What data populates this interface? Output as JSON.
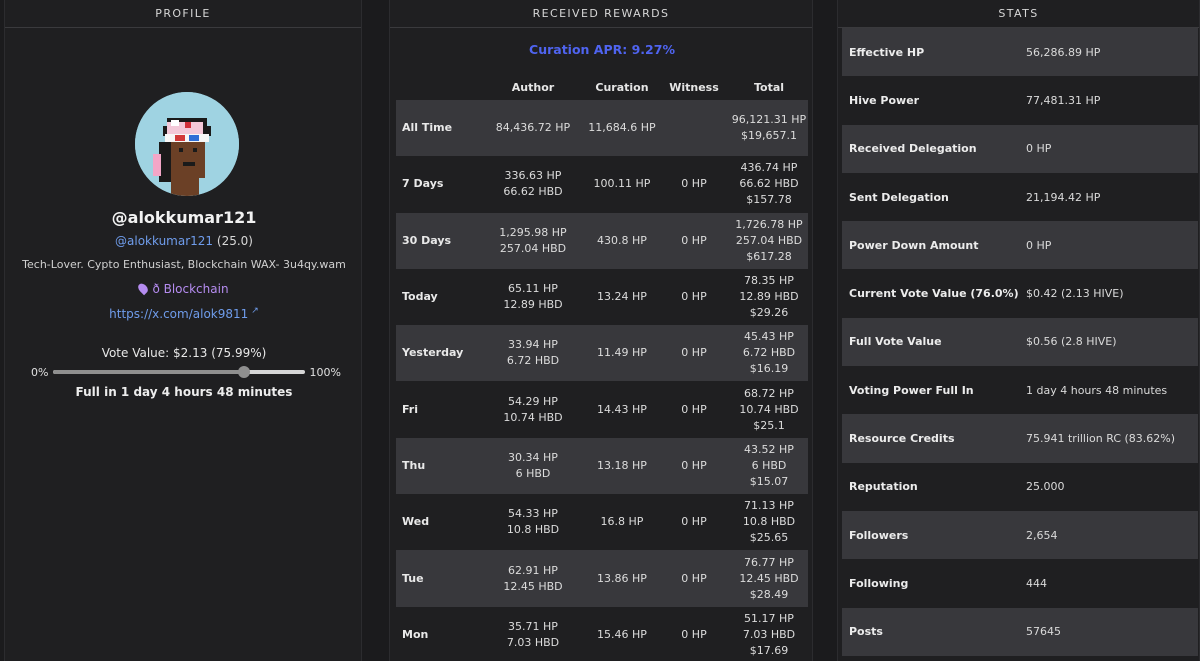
{
  "profile": {
    "header": "PROFILE",
    "username": "@alokkumar121",
    "handle": "@alokkumar121",
    "reputation": "(25.0)",
    "bio": "Tech-Lover. Cypto Enthusiast, Blockchain WAX- 3u4qy.wam",
    "location": "ð Blockchain",
    "website": "https://x.com/alok9811",
    "vote_value": "Vote Value: $2.13 (75.99%)",
    "slider_min": "0%",
    "slider_max": "100%",
    "vote_power_fraction": 0.7599,
    "full_in": "Full in 1 day 4 hours 48 minutes"
  },
  "rewards": {
    "header": "RECEIVED REWARDS",
    "apr": "Curation APR: 9.27%",
    "columns": [
      "",
      "Author",
      "Curation",
      "Witness",
      "Total"
    ],
    "rows": [
      {
        "label": "All Time",
        "author": [
          "84,436.72 HP"
        ],
        "curation": "11,684.6 HP",
        "witness": "",
        "total": [
          "96,121.31 HP",
          "$19,657.1"
        ]
      },
      {
        "label": "7 Days",
        "author": [
          "336.63 HP",
          "66.62 HBD"
        ],
        "curation": "100.11 HP",
        "witness": "0 HP",
        "total": [
          "436.74 HP",
          "66.62 HBD",
          "$157.78"
        ]
      },
      {
        "label": "30 Days",
        "author": [
          "1,295.98 HP",
          "257.04 HBD"
        ],
        "curation": "430.8 HP",
        "witness": "0 HP",
        "total": [
          "1,726.78 HP",
          "257.04 HBD",
          "$617.28"
        ]
      },
      {
        "label": "Today",
        "author": [
          "65.11 HP",
          "12.89 HBD"
        ],
        "curation": "13.24 HP",
        "witness": "0 HP",
        "total": [
          "78.35 HP",
          "12.89 HBD",
          "$29.26"
        ]
      },
      {
        "label": "Yesterday",
        "author": [
          "33.94 HP",
          "6.72 HBD"
        ],
        "curation": "11.49 HP",
        "witness": "0 HP",
        "total": [
          "45.43 HP",
          "6.72 HBD",
          "$16.19"
        ]
      },
      {
        "label": "Fri",
        "author": [
          "54.29 HP",
          "10.74 HBD"
        ],
        "curation": "14.43 HP",
        "witness": "0 HP",
        "total": [
          "68.72 HP",
          "10.74 HBD",
          "$25.1"
        ]
      },
      {
        "label": "Thu",
        "author": [
          "30.34 HP",
          "6 HBD"
        ],
        "curation": "13.18 HP",
        "witness": "0 HP",
        "total": [
          "43.52 HP",
          "6 HBD",
          "$15.07"
        ]
      },
      {
        "label": "Wed",
        "author": [
          "54.33 HP",
          "10.8 HBD"
        ],
        "curation": "16.8 HP",
        "witness": "0 HP",
        "total": [
          "71.13 HP",
          "10.8 HBD",
          "$25.65"
        ]
      },
      {
        "label": "Tue",
        "author": [
          "62.91 HP",
          "12.45 HBD"
        ],
        "curation": "13.86 HP",
        "witness": "0 HP",
        "total": [
          "76.77 HP",
          "12.45 HBD",
          "$28.49"
        ]
      },
      {
        "label": "Mon",
        "author": [
          "35.71 HP",
          "7.03 HBD"
        ],
        "curation": "15.46 HP",
        "witness": "0 HP",
        "total": [
          "51.17 HP",
          "7.03 HBD",
          "$17.69"
        ]
      }
    ]
  },
  "stats": {
    "header": "STATS",
    "rows": [
      {
        "label": "Effective HP",
        "value": "56,286.89 HP"
      },
      {
        "label": "Hive Power",
        "value": "77,481.31 HP"
      },
      {
        "label": "Received Delegation",
        "value": "0 HP"
      },
      {
        "label": "Sent Delegation",
        "value": "21,194.42 HP"
      },
      {
        "label": "Power Down Amount",
        "value": "0 HP"
      },
      {
        "label": "Current Vote Value (76.0%)",
        "value": "$0.42 (2.13 HIVE)"
      },
      {
        "label": "Full Vote Value",
        "value": "$0.56 (2.8 HIVE)"
      },
      {
        "label": "Voting Power Full In",
        "value": "1 day 4 hours 48 minutes"
      },
      {
        "label": "Resource Credits",
        "value": "75.941 trillion RC (83.62%)"
      },
      {
        "label": "Reputation",
        "value": "25.000"
      },
      {
        "label": "Followers",
        "value": "2,654"
      },
      {
        "label": "Following",
        "value": "444"
      },
      {
        "label": "Posts",
        "value": "57645"
      }
    ]
  },
  "icons": {
    "location": "map-pin-icon",
    "website": "external-link-icon"
  },
  "colors": {
    "accent_apr": "#4f64f0",
    "link": "#6f9ceb",
    "location": "#b58cf0"
  }
}
